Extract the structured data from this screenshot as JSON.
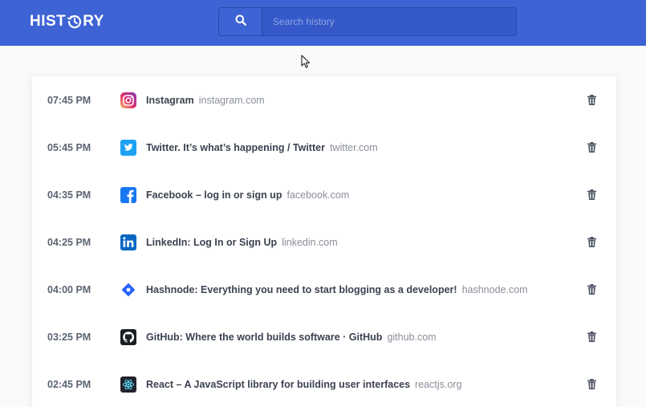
{
  "app": {
    "logo_before": "HIST",
    "logo_after": "RY"
  },
  "search": {
    "placeholder": "Search history",
    "value": ""
  },
  "history": [
    {
      "time": "07:45 PM",
      "title": "Instagram",
      "domain": "instagram.com",
      "icon": "instagram-icon"
    },
    {
      "time": "05:45 PM",
      "title": "Twitter. It’s what’s happening / Twitter",
      "domain": "twitter.com",
      "icon": "twitter-icon"
    },
    {
      "time": "04:35 PM",
      "title": "Facebook – log in or sign up",
      "domain": "facebook.com",
      "icon": "facebook-icon"
    },
    {
      "time": "04:25 PM",
      "title": "LinkedIn: Log In or Sign Up",
      "domain": "linkedin.com",
      "icon": "linkedin-icon"
    },
    {
      "time": "04:00 PM",
      "title": "Hashnode: Everything you need to start blogging as a developer!",
      "domain": "hashnode.com",
      "icon": "hashnode-icon"
    },
    {
      "time": "03:25 PM",
      "title": "GitHub: Where the world builds software · GitHub",
      "domain": "github.com",
      "icon": "github-icon"
    },
    {
      "time": "02:45 PM",
      "title": "React – A JavaScript library for building user interfaces",
      "domain": "reactjs.org",
      "icon": "react-icon"
    }
  ],
  "colors": {
    "header": "#3e63d4",
    "background": "#f9fafb",
    "time_text": "#5b6472",
    "title_text": "#3b4250",
    "domain_text": "#8a8f99"
  }
}
